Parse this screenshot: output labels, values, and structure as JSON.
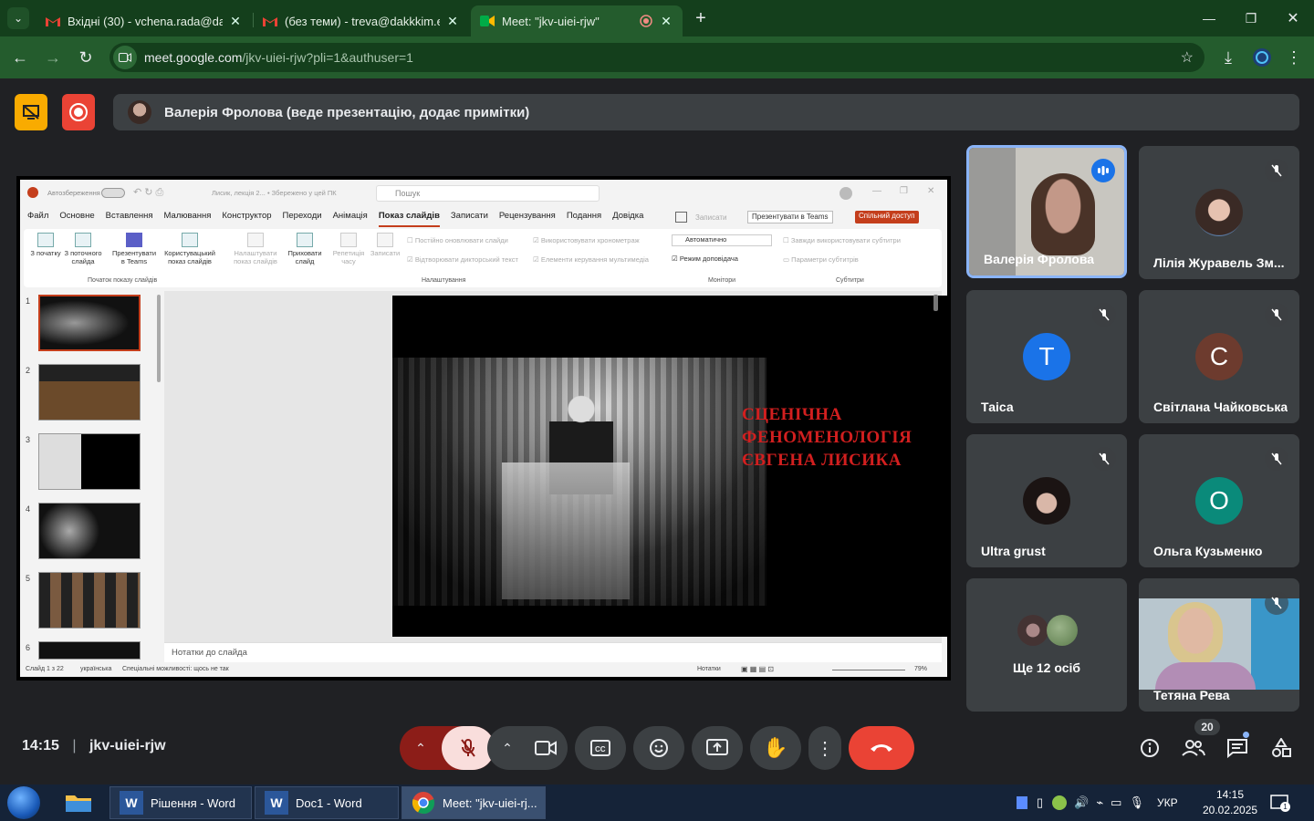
{
  "browser": {
    "tabs": [
      {
        "title": "Вхідні (30) - vchena.rada@dakk",
        "favicon": "gmail-icon"
      },
      {
        "title": "(без теми) - treva@dakkkim.ed",
        "favicon": "gmail-icon"
      },
      {
        "title": "Meet: \"jkv-uiei-rjw\"",
        "favicon": "meet-icon"
      }
    ],
    "url_host": "meet.google.com",
    "url_path": "/jkv-uiei-rjw?pli=1&authuser=1"
  },
  "meet": {
    "presenter_text": "Валерія Фролова (веде презентацію, додає примітки)",
    "meeting_time": "14:15",
    "meeting_code": "jkv-uiei-rjw",
    "participant_count": "20",
    "participants": [
      {
        "name": "Валерія Фролова",
        "type": "video",
        "speaking": true
      },
      {
        "name": "Лілія Журавель Зм...",
        "type": "photo"
      },
      {
        "name": "Таіса",
        "avatar_letter": "T",
        "avatar_color": "#1a73e8"
      },
      {
        "name": "Світлана Чайковська",
        "avatar_letter": "C",
        "avatar_color": "#6d3b2e"
      },
      {
        "name": "Ultra grust",
        "type": "photo"
      },
      {
        "name": "Ольга Кузьменко",
        "avatar_letter": "O",
        "avatar_color": "#0a8a7a"
      },
      {
        "name": "Ще 12 осіб",
        "type": "group"
      },
      {
        "name": "Тетяна Рева",
        "type": "video"
      }
    ],
    "colors": {
      "end_call": "#ea4335",
      "mic_off_bg": "#f9dedc",
      "accent": "#1a73e8"
    }
  },
  "ppt": {
    "autosave_label": "Автозбереження",
    "file_label": "Лисик, лекція 2... • Збережено у цей ПК",
    "search_placeholder": "Пошук",
    "menu": [
      "Файл",
      "Основне",
      "Вставлення",
      "Малювання",
      "Конструктор",
      "Переходи",
      "Анімація",
      "Показ слайдів",
      "Записати",
      "Рецензування",
      "Подання",
      "Довідка"
    ],
    "active_menu": "Показ слайдів",
    "record_label": "Записати",
    "present_teams": "Презентувати в Teams",
    "share": "Спільний доступ",
    "ribbon": {
      "from_beginning": "З початку",
      "from_current": "З поточного слайда",
      "present_teams": "Презентувати в Teams",
      "custom_show": "Користувацький показ слайдів",
      "setup": "Налаштувати показ слайдів",
      "hide": "Приховати слайд",
      "rehearse": "Репетиція часу",
      "record": "Записати",
      "chk_update": "Постійно оновлювати слайди",
      "chk_timings": "Використовувати хронометраж",
      "chk_narration": "Відтворювати дикторський текст",
      "chk_media": "Елементи керування мультимедіа",
      "monitor_value": "Автоматично",
      "presenter_view": "Режим доповідача",
      "always_subtitles": "Завжди використовувати субтитри",
      "subtitle_settings": "Параметри субтитрів",
      "group_start": "Початок показу слайдів",
      "group_setup": "Налаштування",
      "group_monitors": "Монітори",
      "group_subtitles": "Субтитри"
    },
    "thumbnails": [
      "1",
      "2",
      "3",
      "4",
      "5",
      "6"
    ],
    "slide_title": "СЦЕНІЧНА\nФЕНОМЕНОЛОГІЯ\n ЄВГЕНА ЛИСИКА",
    "notes_placeholder": "Нотатки до слайда",
    "status_slide": "Слайд 1 з 22",
    "status_lang": "українська",
    "status_access": "Спеціальні можливості: щось не так",
    "notes_btn": "Нотатки",
    "zoom": "79%"
  },
  "taskbar": {
    "items": [
      {
        "label": "Рішення - Word"
      },
      {
        "label": "Doc1 - Word"
      },
      {
        "label": "Meet: \"jkv-uiei-rj..."
      }
    ],
    "lang": "УКР",
    "time": "14:15",
    "date": "20.02.2025",
    "notif_count": "1"
  }
}
